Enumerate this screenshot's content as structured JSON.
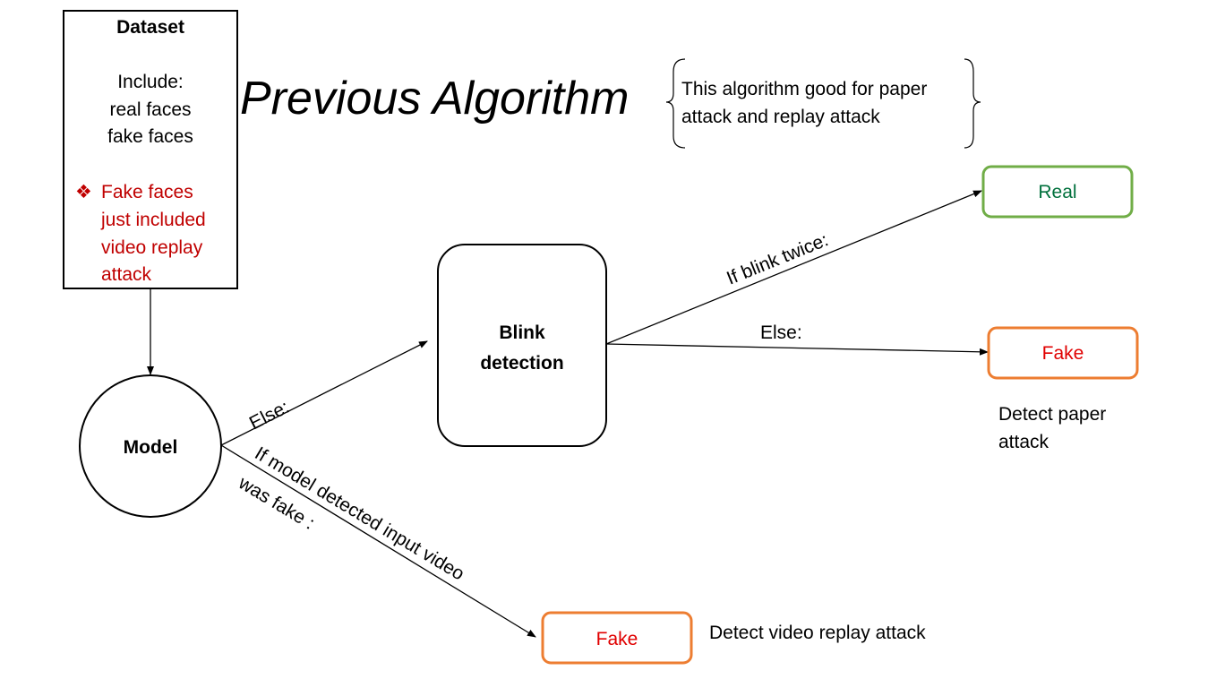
{
  "title": "Previous Algorithm",
  "note": {
    "line1": "This algorithm good for paper",
    "line2": "attack and replay attack"
  },
  "dataset": {
    "heading": "Dataset",
    "include_label": "Include:",
    "items": [
      "real faces",
      "fake faces"
    ],
    "bullet_icon": "diamond-bullet-icon",
    "warning_lines": [
      "Fake faces",
      "just included",
      "video replay",
      "attack"
    ]
  },
  "model": {
    "label": "Model"
  },
  "blink": {
    "line1": "Blink",
    "line2": "detection"
  },
  "edges": {
    "model_else": "Else:",
    "model_fake_line1": "If model detected input video",
    "model_fake_line2": "was fake :",
    "blink_twice": "If blink twice:",
    "blink_else": "Else:"
  },
  "outputs": {
    "real": "Real",
    "fake_paper": "Fake",
    "fake_video": "Fake",
    "paper_note_line1": "Detect paper",
    "paper_note_line2": "attack",
    "video_note": "Detect video replay attack"
  },
  "colors": {
    "green_border": "#70ad47",
    "green_text": "#00703c",
    "orange_border": "#ed7d31",
    "red_text": "#e00000",
    "dark_red": "#c00000"
  }
}
